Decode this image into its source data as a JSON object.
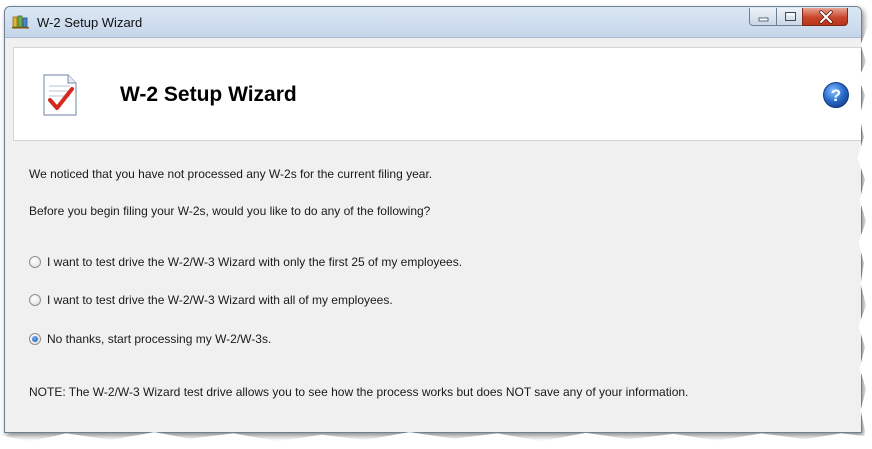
{
  "window": {
    "title": "W-2 Setup Wizard",
    "controls": {
      "minimize": "minimize-icon",
      "maximize": "maximize-icon",
      "close": "close-icon"
    }
  },
  "header": {
    "title": "W-2 Setup Wizard",
    "icon": "document-checkmark-icon",
    "help_icon": "help-icon"
  },
  "body": {
    "intro_line_1": "We noticed that you have not processed any W-2s for the current filing year.",
    "intro_line_2": "Before you begin filing your W-2s, would you like to do any of the following?",
    "options": [
      {
        "label": "I want to test drive the W-2/W-3 Wizard with only the first 25 of my employees.",
        "selected": false
      },
      {
        "label": "I want to test drive the W-2/W-3 Wizard with all of my employees.",
        "selected": false
      },
      {
        "label": "No thanks, start processing my W-2/W-3s.",
        "selected": true
      }
    ],
    "note": "NOTE: The W-2/W-3 Wizard test drive allows you to see how the process works but does NOT save any of your information."
  },
  "colors": {
    "titlebar": "#c5d6ea",
    "close_button": "#c9462c",
    "panel_background": "#f0f0f0",
    "help_icon": "#2a6fd0"
  }
}
